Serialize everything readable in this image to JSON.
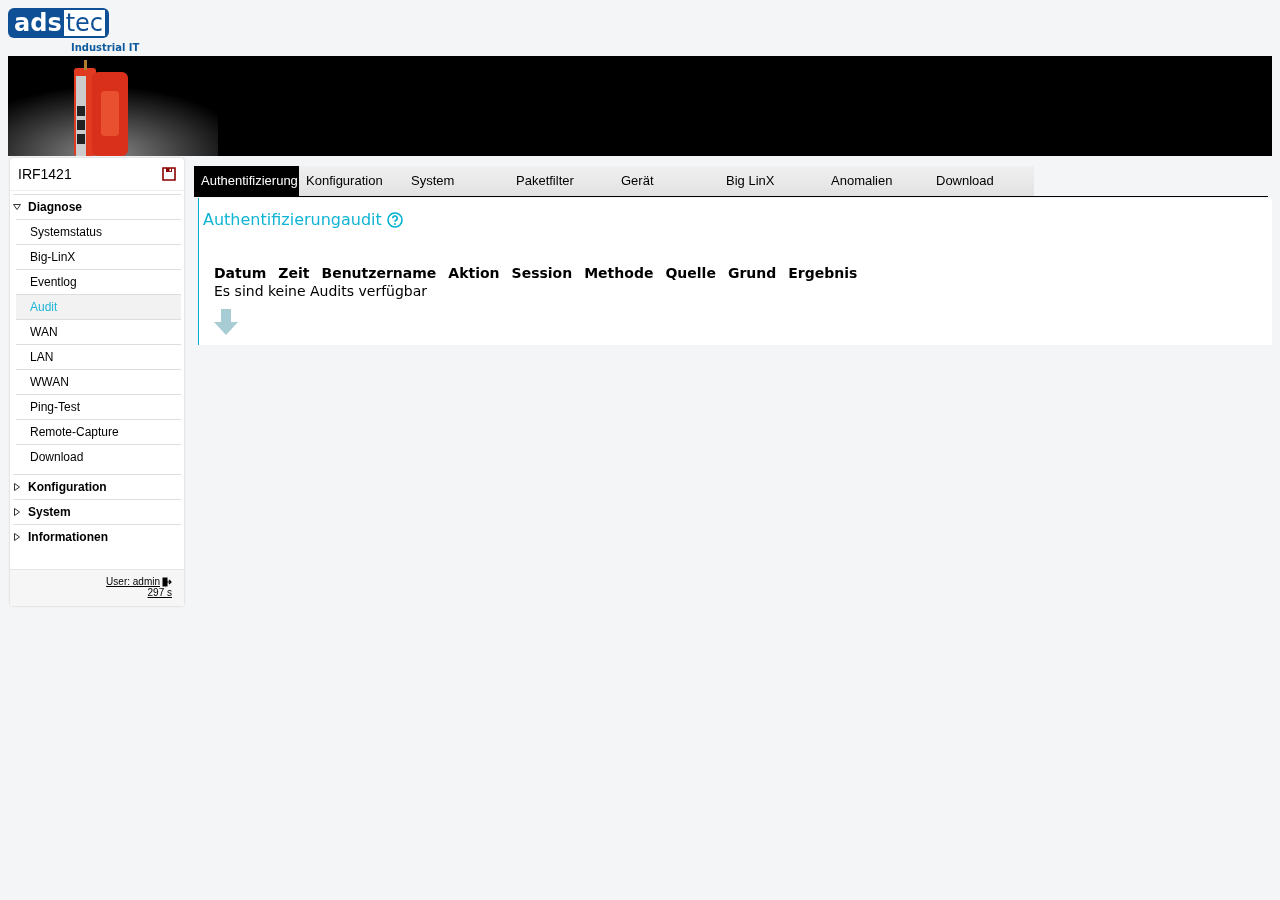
{
  "logo": {
    "left": "ads",
    "right": "tec",
    "tagline": "Industrial IT"
  },
  "sidebar": {
    "device": "IRF1421",
    "sections": [
      {
        "label": "Diagnose",
        "expanded": true,
        "children": [
          {
            "label": "Systemstatus",
            "selected": false
          },
          {
            "label": "Big-LinX",
            "selected": false
          },
          {
            "label": "Eventlog",
            "selected": false
          },
          {
            "label": "Audit",
            "selected": true
          },
          {
            "label": "WAN",
            "selected": false
          },
          {
            "label": "LAN",
            "selected": false
          },
          {
            "label": "WWAN",
            "selected": false
          },
          {
            "label": "Ping-Test",
            "selected": false
          },
          {
            "label": "Remote-Capture",
            "selected": false
          },
          {
            "label": "Download",
            "selected": false
          }
        ]
      },
      {
        "label": "Konfiguration",
        "expanded": false
      },
      {
        "label": "System",
        "expanded": false
      },
      {
        "label": "Informationen",
        "expanded": false
      }
    ],
    "user": "User: admin",
    "timer": "297 s"
  },
  "tabs": [
    {
      "label": "Authentifizierung",
      "selected": true
    },
    {
      "label": "Konfiguration",
      "selected": false
    },
    {
      "label": "System",
      "selected": false
    },
    {
      "label": "Paketfilter",
      "selected": false
    },
    {
      "label": "Gerät",
      "selected": false
    },
    {
      "label": "Big LinX",
      "selected": false
    },
    {
      "label": "Anomalien",
      "selected": false
    },
    {
      "label": "Download",
      "selected": false
    }
  ],
  "panel": {
    "title": "Authentifizierungaudit",
    "table": {
      "columns": [
        "Datum",
        "Zeit",
        "Benutzername",
        "Aktion",
        "Session",
        "Methode",
        "Quelle",
        "Grund",
        "Ergebnis"
      ],
      "empty_message": "Es sind keine Audits verfügbar"
    }
  }
}
